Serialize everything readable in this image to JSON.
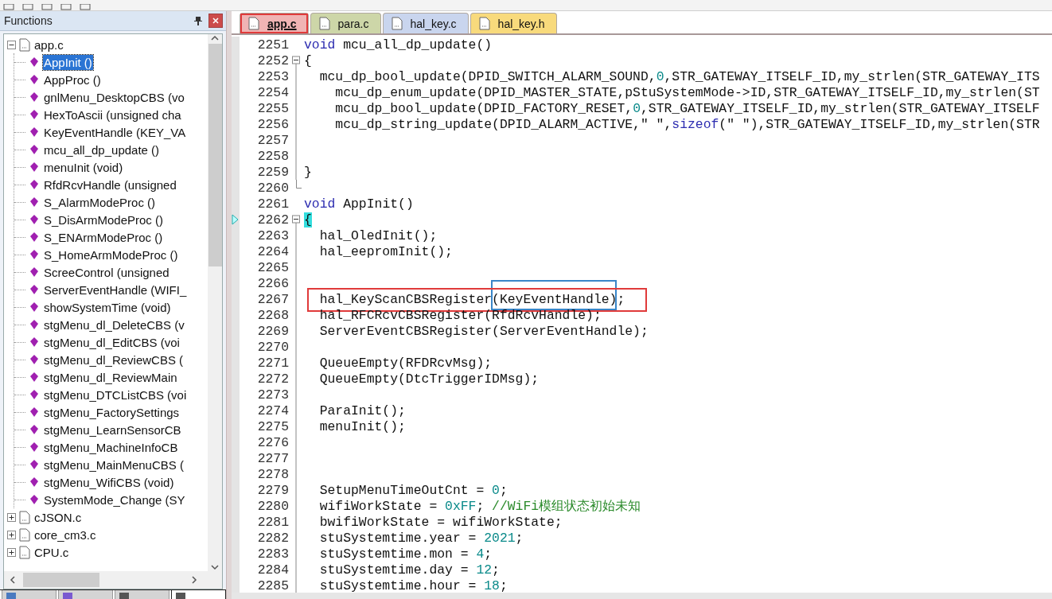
{
  "functions_panel": {
    "title": "Functions",
    "tree": [
      {
        "label": "app.c",
        "expanded": true,
        "children": [
          {
            "label": "AppInit ()",
            "selected": true
          },
          {
            "label": "AppProc ()",
            "selected": false
          },
          {
            "label": "gnlMenu_DesktopCBS (vo",
            "selected": false
          },
          {
            "label": "HexToAscii (unsigned cha",
            "selected": false
          },
          {
            "label": "KeyEventHandle (KEY_VA",
            "selected": false
          },
          {
            "label": "mcu_all_dp_update ()",
            "selected": false
          },
          {
            "label": "menuInit (void)",
            "selected": false
          },
          {
            "label": "RfdRcvHandle (unsigned",
            "selected": false
          },
          {
            "label": "S_AlarmModeProc ()",
            "selected": false
          },
          {
            "label": "S_DisArmModeProc ()",
            "selected": false
          },
          {
            "label": "S_ENArmModeProc ()",
            "selected": false
          },
          {
            "label": "S_HomeArmModeProc ()",
            "selected": false
          },
          {
            "label": "ScreeControl (unsigned",
            "selected": false
          },
          {
            "label": "ServerEventHandle (WIFI_",
            "selected": false
          },
          {
            "label": "showSystemTime (void)",
            "selected": false
          },
          {
            "label": "stgMenu_dl_DeleteCBS (v",
            "selected": false
          },
          {
            "label": "stgMenu_dl_EditCBS (voi",
            "selected": false
          },
          {
            "label": "stgMenu_dl_ReviewCBS (",
            "selected": false
          },
          {
            "label": "stgMenu_dl_ReviewMain",
            "selected": false
          },
          {
            "label": "stgMenu_DTCListCBS (voi",
            "selected": false
          },
          {
            "label": "stgMenu_FactorySettings",
            "selected": false
          },
          {
            "label": "stgMenu_LearnSensorCB",
            "selected": false
          },
          {
            "label": "stgMenu_MachineInfoCB",
            "selected": false
          },
          {
            "label": "stgMenu_MainMenuCBS (",
            "selected": false
          },
          {
            "label": "stgMenu_WifiCBS (void)",
            "selected": false
          },
          {
            "label": "SystemMode_Change (SY",
            "selected": false
          }
        ]
      },
      {
        "label": "cJSON.c",
        "expanded": false
      },
      {
        "label": "core_cm3.c",
        "expanded": false
      },
      {
        "label": "CPU.c",
        "expanded": false
      }
    ],
    "panel_tabs": [
      {
        "selected": false
      },
      {
        "selected": false
      },
      {
        "selected": false
      },
      {
        "selected": true
      }
    ]
  },
  "editor": {
    "tabs": [
      {
        "label": "app.c",
        "selected": true,
        "annotated": true,
        "color": "#f0b4b4"
      },
      {
        "label": "para.c",
        "selected": false,
        "annotated": false,
        "color": "#cdd6a8"
      },
      {
        "label": "hal_key.c",
        "selected": false,
        "annotated": false,
        "color": "#c9d5ee"
      },
      {
        "label": "hal_key.h",
        "selected": false,
        "annotated": false,
        "color": "#f8da7c"
      }
    ],
    "lines": [
      {
        "n": "2251",
        "kind": "plain",
        "marker": false,
        "boxed": false,
        "tokens": [
          {
            "kind": "keyword",
            "text": "void"
          },
          {
            "kind": "plain",
            "text": " mcu_all_dp_update()"
          }
        ]
      },
      {
        "n": "2252",
        "kind": "fold_start",
        "marker": false,
        "boxed": false,
        "tokens": [
          {
            "kind": "plain",
            "text": "{"
          }
        ]
      },
      {
        "n": "2253",
        "kind": "fold_body",
        "marker": false,
        "boxed": false,
        "tokens": [
          {
            "kind": "plain",
            "text": "  mcu_dp_bool_update(DPID_SWITCH_ALARM_SOUND,"
          },
          {
            "kind": "number",
            "text": "0"
          },
          {
            "kind": "plain",
            "text": ",STR_GATEWAY_ITSELF_ID,my_strlen(STR_GATEWAY_ITS"
          }
        ]
      },
      {
        "n": "2254",
        "kind": "fold_body",
        "marker": false,
        "boxed": false,
        "tokens": [
          {
            "kind": "plain",
            "text": "    mcu_dp_enum_update(DPID_MASTER_STATE,pStuSystemMode->ID,STR_GATEWAY_ITSELF_ID,my_strlen(ST"
          }
        ]
      },
      {
        "n": "2255",
        "kind": "fold_body",
        "marker": false,
        "boxed": false,
        "tokens": [
          {
            "kind": "plain",
            "text": "    mcu_dp_bool_update(DPID_FACTORY_RESET,"
          },
          {
            "kind": "number",
            "text": "0"
          },
          {
            "kind": "plain",
            "text": ",STR_GATEWAY_ITSELF_ID,my_strlen(STR_GATEWAY_ITSELF"
          }
        ]
      },
      {
        "n": "2256",
        "kind": "fold_body",
        "marker": false,
        "boxed": false,
        "tokens": [
          {
            "kind": "plain",
            "text": "    mcu_dp_string_update(DPID_ALARM_ACTIVE,\" \","
          },
          {
            "kind": "keyword",
            "text": "sizeof"
          },
          {
            "kind": "plain",
            "text": "(\" \"),STR_GATEWAY_ITSELF_ID,my_strlen(STR"
          }
        ]
      },
      {
        "n": "2257",
        "kind": "fold_body",
        "marker": false,
        "boxed": false
      },
      {
        "n": "2258",
        "kind": "fold_body",
        "marker": false,
        "boxed": false
      },
      {
        "n": "2259",
        "kind": "fold_body",
        "marker": false,
        "boxed": false,
        "tokens": [
          {
            "kind": "plain",
            "text": "}"
          }
        ]
      },
      {
        "n": "2260",
        "kind": "fold_end",
        "marker": false,
        "boxed": false
      },
      {
        "n": "2261",
        "kind": "plain",
        "marker": false,
        "boxed": false,
        "tokens": [
          {
            "kind": "keyword",
            "text": "void"
          },
          {
            "kind": "plain",
            "text": " AppInit()"
          }
        ]
      },
      {
        "n": "2262",
        "kind": "fold_start",
        "marker": true,
        "boxed": false,
        "tokens": [
          {
            "kind": "brace_match",
            "text": "{"
          }
        ]
      },
      {
        "n": "2263",
        "kind": "fold_body",
        "marker": false,
        "boxed": false,
        "tokens": [
          {
            "kind": "plain",
            "text": "  hal_OledInit();"
          }
        ]
      },
      {
        "n": "2264",
        "kind": "fold_body",
        "marker": false,
        "boxed": false,
        "tokens": [
          {
            "kind": "plain",
            "text": "  hal_eepromInit();"
          }
        ]
      },
      {
        "n": "2265",
        "kind": "fold_body",
        "marker": false,
        "boxed": false
      },
      {
        "n": "2266",
        "kind": "fold_body",
        "marker": false,
        "boxed": false
      },
      {
        "n": "2267",
        "kind": "fold_body",
        "marker": false,
        "boxed": true,
        "tokens": [
          {
            "kind": "plain",
            "text": "  hal_KeyScanCBSRegister"
          },
          {
            "kind": "framed",
            "text": "(KeyEventHandle)"
          },
          {
            "kind": "plain",
            "text": ";"
          }
        ]
      },
      {
        "n": "2268",
        "kind": "fold_body",
        "marker": false,
        "boxed": false,
        "tokens": [
          {
            "kind": "plain",
            "text": "  hal_RFCRcvCBSRegister(RfdRcvHandle);"
          }
        ]
      },
      {
        "n": "2269",
        "kind": "fold_body",
        "marker": false,
        "boxed": false,
        "tokens": [
          {
            "kind": "plain",
            "text": "  ServerEventCBSRegister(ServerEventHandle);"
          }
        ]
      },
      {
        "n": "2270",
        "kind": "fold_body",
        "marker": false,
        "boxed": false
      },
      {
        "n": "2271",
        "kind": "fold_body",
        "marker": false,
        "boxed": false,
        "tokens": [
          {
            "kind": "plain",
            "text": "  QueueEmpty(RFDRcvMsg);"
          }
        ]
      },
      {
        "n": "2272",
        "kind": "fold_body",
        "marker": false,
        "boxed": false,
        "tokens": [
          {
            "kind": "plain",
            "text": "  QueueEmpty(DtcTriggerIDMsg);"
          }
        ]
      },
      {
        "n": "2273",
        "kind": "fold_body",
        "marker": false,
        "boxed": false
      },
      {
        "n": "2274",
        "kind": "fold_body",
        "marker": false,
        "boxed": false,
        "tokens": [
          {
            "kind": "plain",
            "text": "  ParaInit();"
          }
        ]
      },
      {
        "n": "2275",
        "kind": "fold_body",
        "marker": false,
        "boxed": false,
        "tokens": [
          {
            "kind": "plain",
            "text": "  menuInit();"
          }
        ]
      },
      {
        "n": "2276",
        "kind": "fold_body",
        "marker": false,
        "boxed": false
      },
      {
        "n": "2277",
        "kind": "fold_body",
        "marker": false,
        "boxed": false
      },
      {
        "n": "2278",
        "kind": "fold_body",
        "marker": false,
        "boxed": false
      },
      {
        "n": "2279",
        "kind": "fold_body",
        "marker": false,
        "boxed": false,
        "tokens": [
          {
            "kind": "plain",
            "text": "  SetupMenuTimeOutCnt = "
          },
          {
            "kind": "number",
            "text": "0"
          },
          {
            "kind": "plain",
            "text": ";"
          }
        ]
      },
      {
        "n": "2280",
        "kind": "fold_body",
        "marker": false,
        "boxed": false,
        "tokens": [
          {
            "kind": "plain",
            "text": "  wifiWorkState = "
          },
          {
            "kind": "number",
            "text": "0xFF"
          },
          {
            "kind": "plain",
            "text": "; "
          },
          {
            "kind": "comment",
            "text": "//WiFi模组状态初始未知"
          }
        ]
      },
      {
        "n": "2281",
        "kind": "fold_body",
        "marker": false,
        "boxed": false,
        "tokens": [
          {
            "kind": "plain",
            "text": "  bwifiWorkState = wifiWorkState;"
          }
        ]
      },
      {
        "n": "2282",
        "kind": "fold_body",
        "marker": false,
        "boxed": false,
        "tokens": [
          {
            "kind": "plain",
            "text": "  stuSystemtime.year = "
          },
          {
            "kind": "number",
            "text": "2021"
          },
          {
            "kind": "plain",
            "text": ";"
          }
        ]
      },
      {
        "n": "2283",
        "kind": "fold_body",
        "marker": false,
        "boxed": false,
        "tokens": [
          {
            "kind": "plain",
            "text": "  stuSystemtime.mon = "
          },
          {
            "kind": "number",
            "text": "4"
          },
          {
            "kind": "plain",
            "text": ";"
          }
        ]
      },
      {
        "n": "2284",
        "kind": "fold_body",
        "marker": false,
        "boxed": false,
        "tokens": [
          {
            "kind": "plain",
            "text": "  stuSystemtime.day = "
          },
          {
            "kind": "number",
            "text": "12"
          },
          {
            "kind": "plain",
            "text": ";"
          }
        ]
      },
      {
        "n": "2285",
        "kind": "fold_body",
        "marker": false,
        "boxed": false,
        "tokens": [
          {
            "kind": "plain",
            "text": "  stuSystemtime.hour = "
          },
          {
            "kind": "number",
            "text": "18"
          },
          {
            "kind": "plain",
            "text": ";"
          }
        ]
      }
    ]
  }
}
